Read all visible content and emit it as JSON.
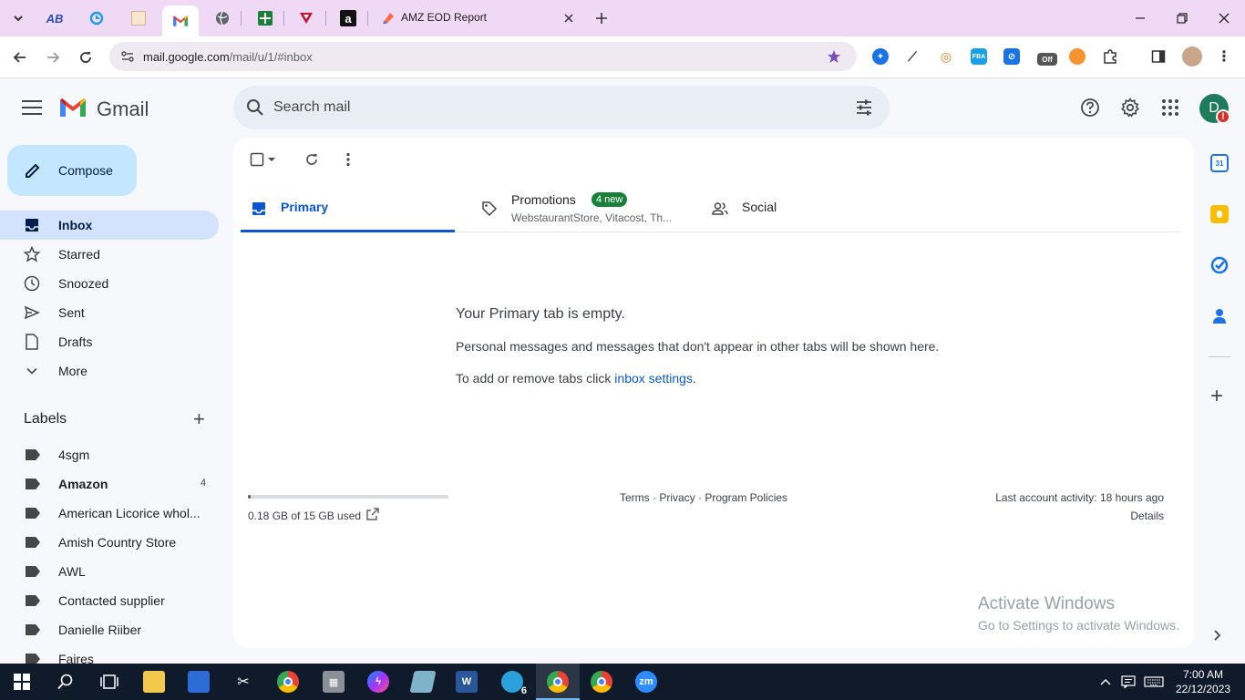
{
  "browser": {
    "active_tab_title": "AMZ EOD Report",
    "url_host": "mail.google.com",
    "url_path": "/mail/u/1/#inbox",
    "ext_off_label": "Off",
    "ext_fba_label": "FBA"
  },
  "gmail": {
    "logo_text": "Gmail",
    "search_placeholder": "Search mail",
    "avatar_initial": "D",
    "avatar_badge": "!",
    "compose_label": "Compose",
    "nav": [
      {
        "label": "Inbox"
      },
      {
        "label": "Starred"
      },
      {
        "label": "Snoozed"
      },
      {
        "label": "Sent"
      },
      {
        "label": "Drafts"
      },
      {
        "label": "More"
      }
    ],
    "labels_heading": "Labels",
    "labels": [
      {
        "name": "4sgm",
        "count": ""
      },
      {
        "name": "Amazon",
        "count": "4"
      },
      {
        "name": "American Licorice whol...",
        "count": ""
      },
      {
        "name": "Amish Country Store",
        "count": ""
      },
      {
        "name": "AWL",
        "count": ""
      },
      {
        "name": "Contacted supplier",
        "count": ""
      },
      {
        "name": "Danielle Riiber",
        "count": ""
      },
      {
        "name": "Faires",
        "count": ""
      }
    ],
    "tabs": {
      "primary": "Primary",
      "promotions": "Promotions",
      "promotions_badge": "4 new",
      "promotions_senders": "WebstaurantStore, Vitacost, Th...",
      "social": "Social"
    },
    "empty": {
      "title": "Your Primary tab is empty.",
      "description": "Personal messages and messages that don't appear in other tabs will be shown here.",
      "settings_prefix": "To add or remove tabs click ",
      "settings_link": "inbox settings",
      "settings_suffix": "."
    },
    "footer": {
      "storage": "0.18 GB of 15 GB used",
      "storage_fraction": 0.012,
      "links": "Terms · Privacy · Program Policies",
      "activity": "Last account activity: 18 hours ago",
      "details": "Details"
    }
  },
  "watermark": {
    "line1": "Activate Windows",
    "line2": "Go to Settings to activate Windows."
  },
  "taskbar": {
    "telegram_badge": "6",
    "zoom_label": "zm",
    "time": "7:00 AM",
    "date": "22/12/2023"
  },
  "colors": {
    "accent": "#0b57d0",
    "compose_bg": "#c2e7ff",
    "active_nav_bg": "#d3e3fd",
    "tabstrip_bg": "#f0d9f4",
    "promo_badge": "#188038"
  }
}
